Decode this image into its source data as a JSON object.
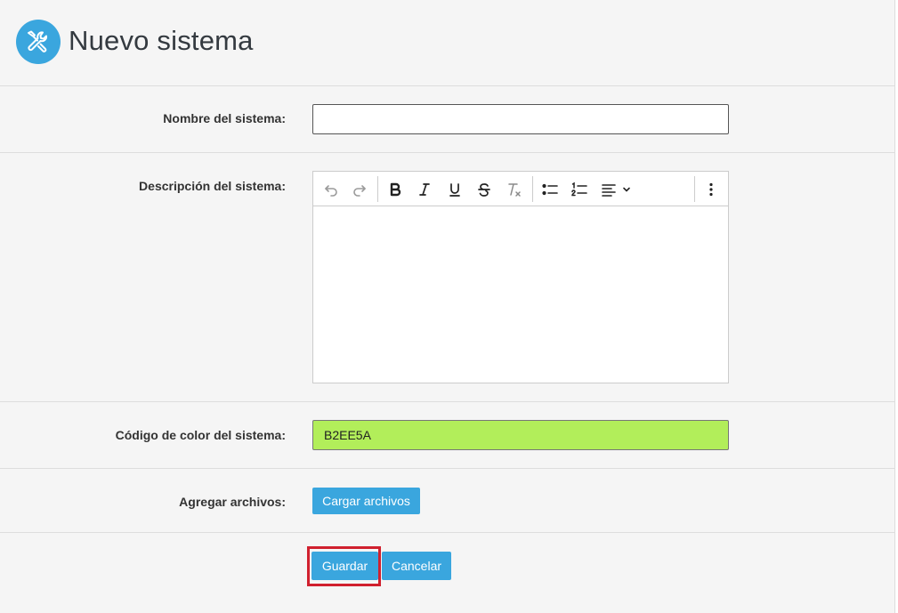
{
  "header": {
    "title": "Nuevo sistema",
    "icon": "tools-icon",
    "icon_bg": "#3aa6de"
  },
  "form": {
    "name": {
      "label": "Nombre del sistema:",
      "value": ""
    },
    "description": {
      "label": "Descripción del sistema:",
      "toolbar": [
        "undo",
        "redo",
        "bold",
        "italic",
        "underline",
        "strikethrough",
        "clear-formatting",
        "bullet-list",
        "numbered-list",
        "align",
        "more"
      ],
      "value": ""
    },
    "color": {
      "label": "Código de color del sistema:",
      "value": "B2EE5A",
      "swatch": "#b2ee5a"
    },
    "files": {
      "label": "Agregar archivos:",
      "button_label": "Cargar archivos"
    }
  },
  "actions": {
    "save_label": "Guardar",
    "cancel_label": "Cancelar",
    "accent": "#3aa6de",
    "highlight": "#d0202e"
  }
}
